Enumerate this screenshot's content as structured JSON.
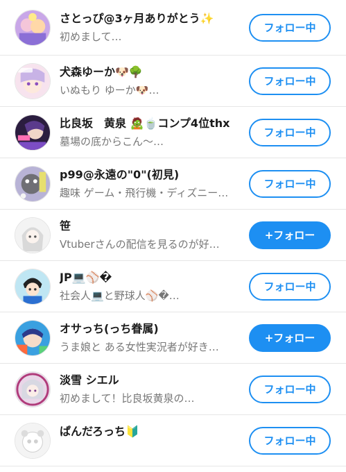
{
  "colors": {
    "accent": "#1d8ff2",
    "divider": "#e6e6e6",
    "bio_text": "#777777"
  },
  "users": [
    {
      "name": "さとっぴ@3ヶ月ありがとう✨",
      "bio": "初めまして…",
      "button": "フォロー中",
      "following": true
    },
    {
      "name": "犬森ゆーか🐶🌳",
      "bio": "いぬもり ゆーか🐶…",
      "button": "フォロー中",
      "following": true
    },
    {
      "name": "比良坂　黄泉 🧟🍵コンプ4位thx",
      "bio": "墓場の底からこん〜…",
      "button": "フォロー中",
      "following": true
    },
    {
      "name": "p99@永遠の\"0\"(初見)",
      "bio": "趣味 ゲーム・飛行機・ディズニー…",
      "button": "フォロー中",
      "following": true
    },
    {
      "name": "笹",
      "bio": "Vtuberさんの配信を見るのが好…",
      "button": "+フォロー",
      "following": false
    },
    {
      "name": "JP💻⚾�",
      "bio": "社会人💻と野球人⚾�…",
      "button": "フォロー中",
      "following": true
    },
    {
      "name": "オサっち(っち眷属)",
      "bio": "うま娘と ある女性実況者が好き…",
      "button": "+フォロー",
      "following": false
    },
    {
      "name": "淡雪 シエル",
      "bio": "初めまして！比良坂黄泉の…",
      "button": "フォロー中",
      "following": true
    },
    {
      "name": "ぱんだろっち🔰",
      "bio": "",
      "button": "フォロー中",
      "following": true
    }
  ]
}
